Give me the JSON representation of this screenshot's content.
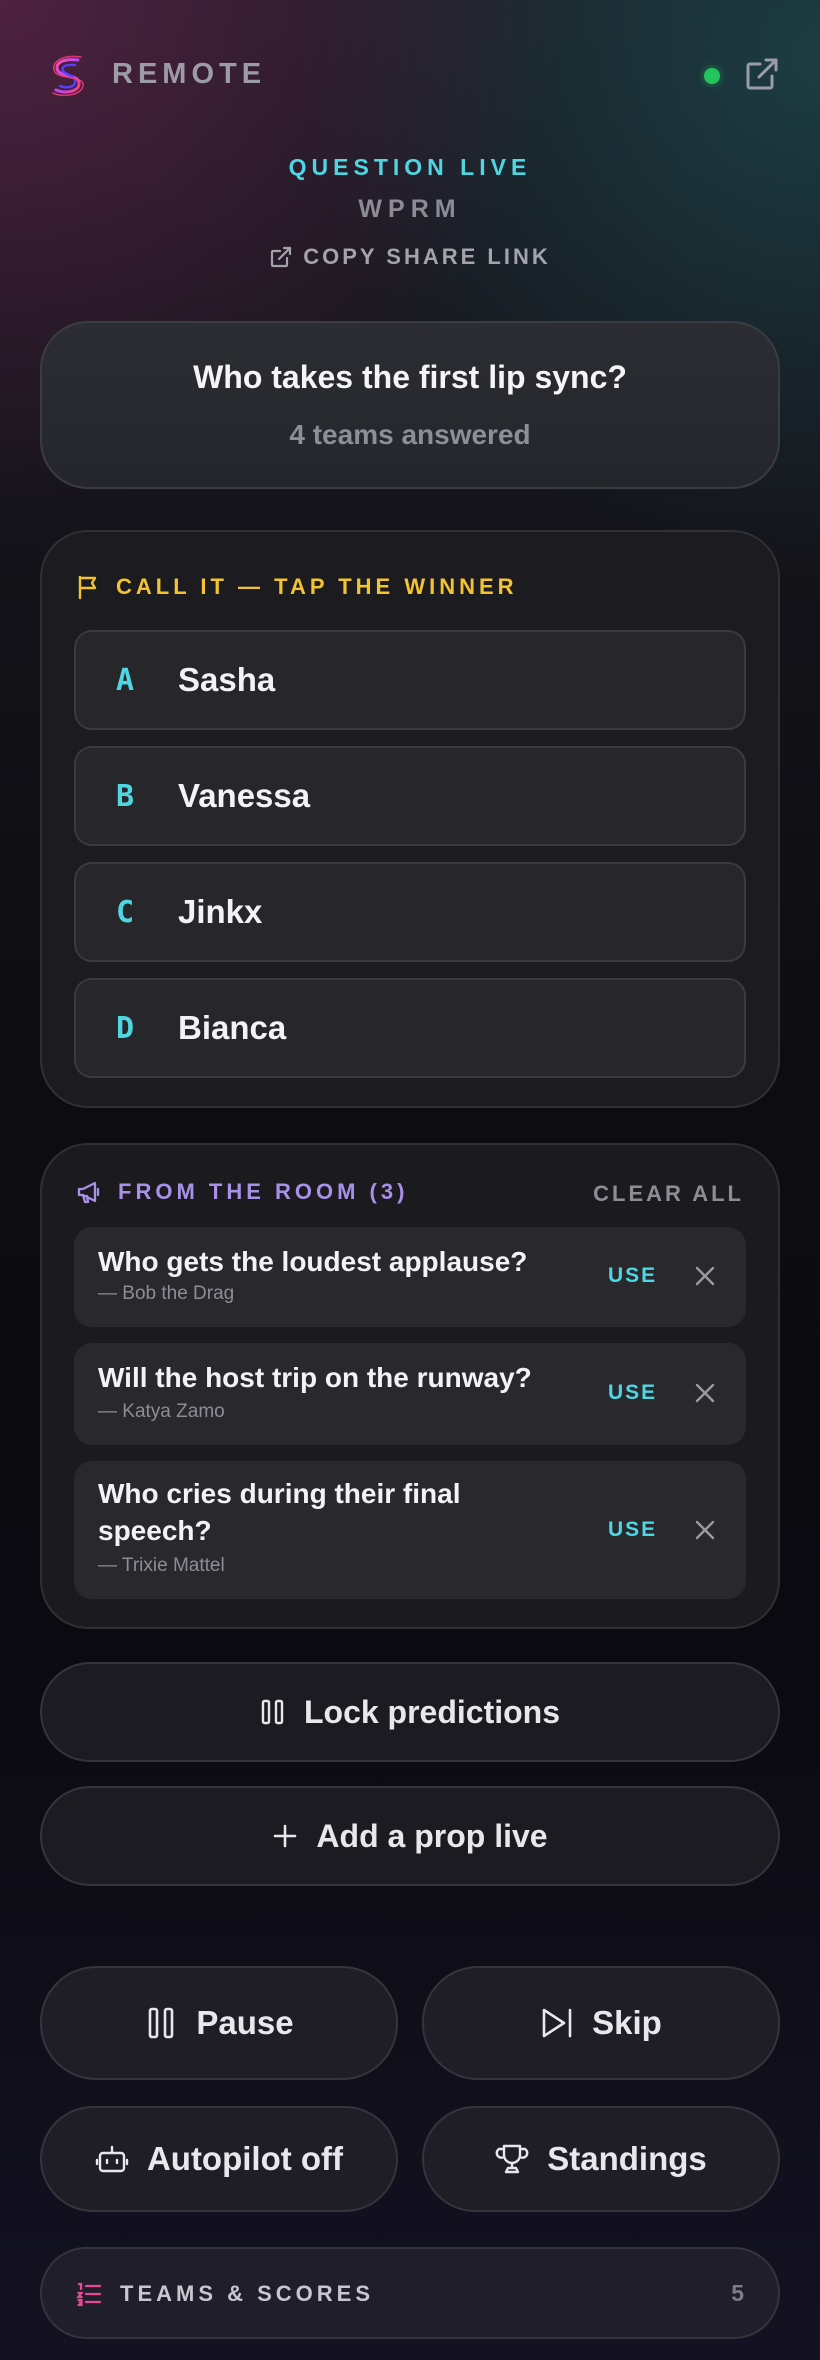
{
  "header": {
    "brand": "REMOTE",
    "live_dot_color": "#22c55e",
    "open_external_icon": "external-link-icon"
  },
  "session": {
    "status": "QUESTION LIVE",
    "code": "WPRM",
    "share_label": "COPY SHARE LINK"
  },
  "question": {
    "title": "Who takes the first lip sync?",
    "answered": "4 teams answered"
  },
  "call_it": {
    "heading": "CALL IT — TAP THE WINNER",
    "options": [
      {
        "letter": "A",
        "name": "Sasha"
      },
      {
        "letter": "B",
        "name": "Vanessa"
      },
      {
        "letter": "C",
        "name": "Jinkx"
      },
      {
        "letter": "D",
        "name": "Bianca"
      }
    ]
  },
  "room": {
    "heading": "FROM THE ROOM (3)",
    "clear_label": "CLEAR ALL",
    "suggestions": [
      {
        "text": "Who gets the loudest applause?",
        "author": "— Bob the Drag",
        "use_label": "USE"
      },
      {
        "text": "Will the host trip on the runway?",
        "author": "— Katya Zamo",
        "use_label": "USE"
      },
      {
        "text": "Who cries during their final speech?",
        "author": "— Trixie Mattel",
        "use_label": "USE"
      }
    ]
  },
  "actions": {
    "lock": "Lock predictions",
    "add_prop": "Add a prop live",
    "pause": "Pause",
    "skip": "Skip",
    "autopilot": "Autopilot off",
    "standings": "Standings"
  },
  "teams": {
    "label": "TEAMS & SCORES",
    "count": "5"
  },
  "colors": {
    "accent_cyan": "#4fd6e3",
    "accent_yellow": "#f4c430",
    "accent_purple": "#a890e8",
    "accent_pink": "#e8489a"
  }
}
